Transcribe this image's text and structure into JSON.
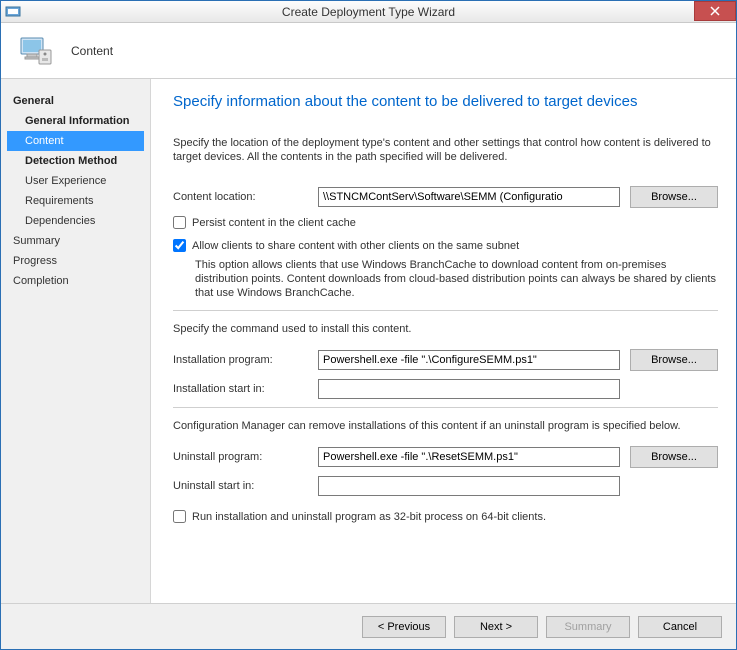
{
  "window": {
    "title": "Create Deployment Type Wizard"
  },
  "header": {
    "page_name": "Content"
  },
  "sidebar": {
    "items": [
      {
        "label": "General"
      },
      {
        "label": "General Information"
      },
      {
        "label": "Content"
      },
      {
        "label": "Detection Method"
      },
      {
        "label": "User Experience"
      },
      {
        "label": "Requirements"
      },
      {
        "label": "Dependencies"
      },
      {
        "label": "Summary"
      },
      {
        "label": "Progress"
      },
      {
        "label": "Completion"
      }
    ]
  },
  "main": {
    "heading": "Specify information about the content to be delivered to target devices",
    "description": "Specify the location of the deployment type's content and other settings that control how content is delivered to target devices. All the contents in the path specified will be delivered.",
    "content_location_label": "Content location:",
    "content_location_value": "\\\\STNCMContServ\\Software\\SEMM (Configuratio",
    "browse": "Browse...",
    "persist_label": "Persist content in the client cache",
    "persist_checked": false,
    "allow_share_label": "Allow clients to share content with other clients on the same subnet",
    "allow_share_checked": true,
    "branchcache_note": "This option allows clients that use Windows BranchCache to download content from on-premises distribution points. Content downloads from cloud-based distribution points can always be shared by clients that use Windows BranchCache.",
    "install_section_intro": "Specify the command used to install this content.",
    "install_program_label": "Installation program:",
    "install_program_value": "Powershell.exe -file \".\\ConfigureSEMM.ps1\"",
    "install_start_label": "Installation start in:",
    "install_start_value": "",
    "uninstall_intro": "Configuration Manager can remove installations of this content if an uninstall program is specified below.",
    "uninstall_program_label": "Uninstall program:",
    "uninstall_program_value": "Powershell.exe -file \".\\ResetSEMM.ps1\"",
    "uninstall_start_label": "Uninstall start in:",
    "uninstall_start_value": "",
    "run32_label": "Run installation and uninstall program as 32-bit process on 64-bit clients.",
    "run32_checked": false
  },
  "footer": {
    "previous": "< Previous",
    "next": "Next >",
    "summary": "Summary",
    "cancel": "Cancel"
  }
}
